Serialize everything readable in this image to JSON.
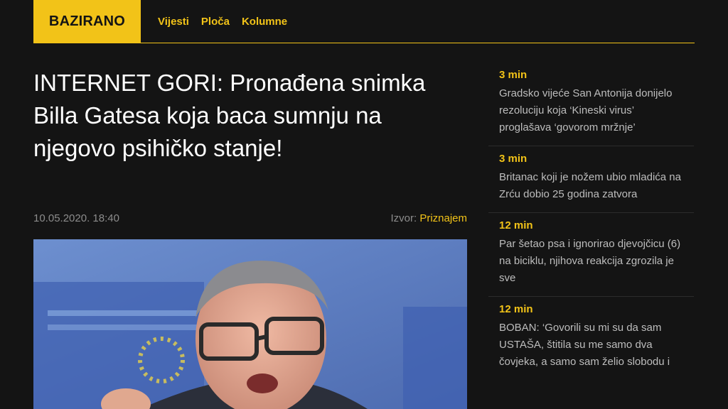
{
  "header": {
    "logo": "BAZIRANO",
    "nav": [
      "Vijesti",
      "Ploča",
      "Kolumne"
    ]
  },
  "article": {
    "title": "INTERNET GORI: Pronađena snimka Billa Gatesa koja baca sumnju na njegovo psihičko stanje!",
    "date": "10.05.2020. 18:40",
    "source_label": "Izvor:",
    "source_name": "Priznajem"
  },
  "sidebar": {
    "items": [
      {
        "time": "3 min",
        "text": "Gradsko vijeće San Antonija donijelo rezoluciju koja ‘Kineski virus’ proglašava ‘govorom mržnje’"
      },
      {
        "time": "3 min",
        "text": "Britanac koji je nožem ubio mladića na Zrću dobio 25 godina zatvora"
      },
      {
        "time": "12 min",
        "text": "Par šetao psa i ignorirao djevojčicu (6) na biciklu, njihova reakcija zgrozila je sve"
      },
      {
        "time": "12 min",
        "text": "BOBAN: ‘Govorili su mi su da sam USTAŠA, štitila su me samo dva čovjeka, a samo sam želio slobodu i"
      }
    ]
  },
  "colors": {
    "accent": "#f2c318",
    "background": "#141414"
  }
}
